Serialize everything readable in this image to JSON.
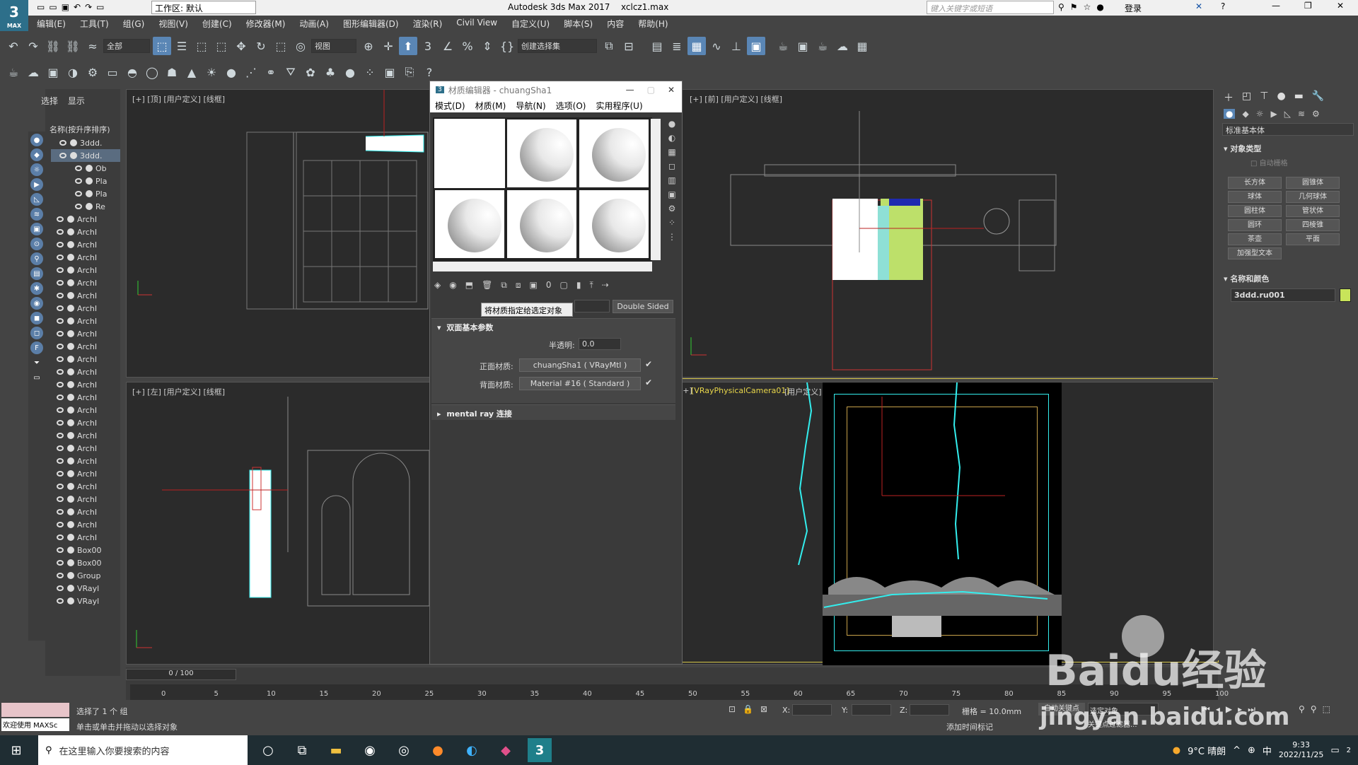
{
  "window": {
    "app_title": "Autodesk 3ds Max 2017",
    "file_name": "xclcz1.max",
    "workspace_label": "工作区: 默认",
    "search_placeholder": "键入关键字或短语",
    "login": "登录"
  },
  "logo": {
    "text": "3",
    "sub": "MAX"
  },
  "menu": [
    "编辑(E)",
    "工具(T)",
    "组(G)",
    "视图(V)",
    "创建(C)",
    "修改器(M)",
    "动画(A)",
    "图形编辑器(D)",
    "渲染(R)",
    "Civil View",
    "自定义(U)",
    "脚本(S)",
    "内容",
    "帮助(H)"
  ],
  "toolbar1": {
    "filter_select": "全部",
    "view_select": "视图",
    "selection_set": "创建选择集"
  },
  "scene": {
    "tab_select": "选择",
    "tab_display": "显示",
    "header": "名称(按升序排序)",
    "rows": [
      "3ddd.",
      "3ddd.",
      "Ob",
      "Pla",
      "Pla",
      "Re",
      "ArchI",
      "ArchI",
      "ArchI",
      "ArchI",
      "ArchI",
      "ArchI",
      "ArchI",
      "ArchI",
      "ArchI",
      "ArchI",
      "ArchI",
      "ArchI",
      "ArchI",
      "ArchI",
      "ArchI",
      "ArchI",
      "ArchI",
      "ArchI",
      "ArchI",
      "ArchI",
      "ArchI",
      "ArchI",
      "ArchI",
      "ArchI",
      "ArchI",
      "ArchI",
      "Box00",
      "Box00",
      "Group",
      "VRayl",
      "VRayl"
    ]
  },
  "viewports": {
    "top": "[+] [顶] [用户定义] [线框]",
    "front": "[+] [前] [用户定义] [线框]",
    "left": "[+] [左] [用户定义] [线框]",
    "camera_pre": "[+]",
    "camera_name": "[VRayPhysicalCamera01]",
    "camera_post": "[用户定义] [默认明暗处理]"
  },
  "material_editor": {
    "title": "材质编辑器 - chuangSha1",
    "menu": [
      "模式(D)",
      "材质(M)",
      "导航(N)",
      "选项(O)",
      "实用程序(U)"
    ],
    "tooltip": "将材质指定给选定对象",
    "type_button": "Double Sided",
    "rollout_basic": "双面基本参数",
    "translucency_label": "半透明:",
    "translucency_value": "0.0",
    "front_label": "正面材质:",
    "front_value": "chuangSha1 ( VRayMtl )",
    "back_label": "背面材质:",
    "back_value": "Material #16 ( Standard )",
    "rollout_mr": "mental ray 连接"
  },
  "command_panel": {
    "category": "标准基本体",
    "object_type_header": "对象类型",
    "autogrid": "自动栅格",
    "buttons": [
      "长方体",
      "圆锥体",
      "球体",
      "几何球体",
      "圆柱体",
      "管状体",
      "圆环",
      "四棱锥",
      "茶壶",
      "平面",
      "加强型文本"
    ],
    "name_color_header": "名称和颜色",
    "object_name": "3ddd.ru001",
    "object_color": "#c8e45a"
  },
  "timeline": {
    "frame_label": "0 / 100",
    "ticks": [
      "0",
      "5",
      "10",
      "15",
      "20",
      "25",
      "30",
      "35",
      "40",
      "45",
      "50",
      "55",
      "60",
      "65",
      "70",
      "75",
      "80",
      "85",
      "90",
      "95",
      "100"
    ]
  },
  "status": {
    "selected": "选择了 1 个 组",
    "hint": "单击或单击并拖动以选择对象",
    "welcome": "欢迎使用 MAXSc",
    "x_label": "X:",
    "y_label": "Y:",
    "z_label": "Z:",
    "grid": "栅格 = 10.0mm",
    "auto_key": "自动关键点",
    "set_key": "选定对象",
    "add_time_tag": "添加时间标记",
    "key_filters": "关键点过滤器..."
  },
  "taskbar": {
    "search_placeholder": "在这里输入你要搜索的内容",
    "weather": "9°C 晴朗",
    "ime": "中",
    "time": "9:33",
    "date": "2022/11/25",
    "notification_count": "2"
  },
  "watermark": {
    "brand": "Baidu经验",
    "url": "jingyan.baidu.com"
  }
}
